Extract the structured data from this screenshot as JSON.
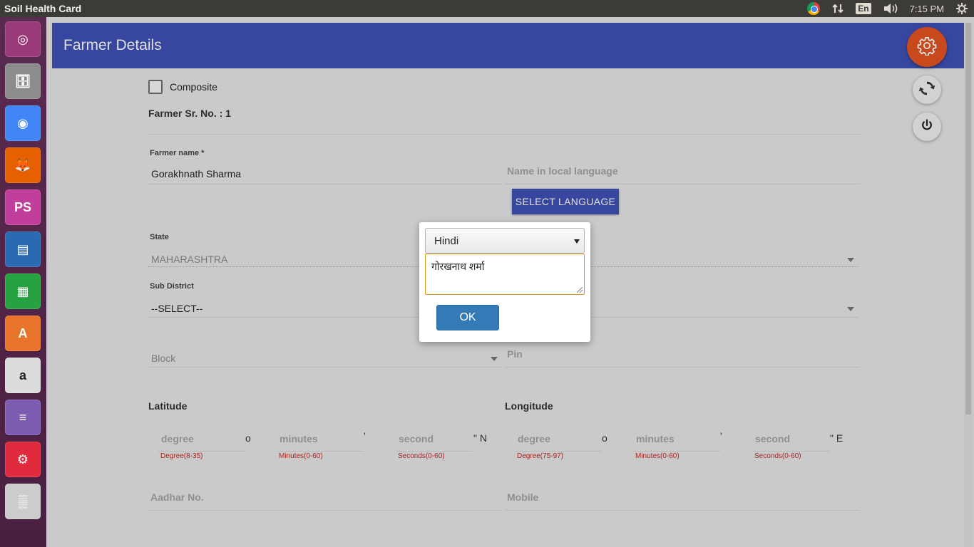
{
  "system": {
    "window_title": "Soil Health Card",
    "keyboard_language": "En",
    "clock": "7:15 PM"
  },
  "launcher": {
    "items": [
      {
        "name": "ubuntu-dash",
        "glyph": "◎",
        "color": "#9b3a7a"
      },
      {
        "name": "files",
        "glyph": "🗄",
        "color": "#8c8c8c"
      },
      {
        "name": "chrome",
        "glyph": "◉",
        "color": "#4285f4"
      },
      {
        "name": "firefox",
        "glyph": "🦊",
        "color": "#e66000"
      },
      {
        "name": "phpstorm",
        "glyph": "PS",
        "color": "#c13f9b"
      },
      {
        "name": "libreoffice-impress",
        "glyph": "▤",
        "color": "#2a6ab2"
      },
      {
        "name": "libreoffice-calc",
        "glyph": "▦",
        "color": "#27a243"
      },
      {
        "name": "software-center",
        "glyph": "A",
        "color": "#e7742a"
      },
      {
        "name": "amazon",
        "glyph": "a",
        "color": "#dcdcdc"
      },
      {
        "name": "stacked-apps",
        "glyph": "≡",
        "color": "#7c5bb0"
      },
      {
        "name": "screenshot-tool",
        "glyph": "⚙",
        "color": "#e02a3d"
      },
      {
        "name": "misc-app",
        "glyph": "▒",
        "color": "#cccccc"
      }
    ]
  },
  "app": {
    "title": "Farmer Details",
    "composite_label": "Composite",
    "farmer_sr_no_label": "Farmer Sr. No. : 1",
    "farmer_name_label": "Farmer name *",
    "farmer_name_value": "Gorakhnath Sharma",
    "local_name_placeholder": "Name in local language",
    "select_language_button": "SELECT LANGUAGE",
    "state_label": "State",
    "state_value": "MAHARASHTRA",
    "sub_district_label": "Sub District",
    "sub_district_value": "--SELECT--",
    "block_placeholder": "Block",
    "pin_placeholder": "Pin",
    "latitude": {
      "title": "Latitude",
      "degree_ph": "degree",
      "degree_sym": "o",
      "degree_hint": "Degree(8-35)",
      "minutes_ph": "minutes",
      "minutes_sym": "'",
      "minutes_hint": "Minutes(0-60)",
      "second_ph": "second",
      "second_sym": "\" N",
      "second_hint": "Seconds(0-60)"
    },
    "longitude": {
      "title": "Longitude",
      "degree_ph": "degree",
      "degree_sym": "o",
      "degree_hint": "Degree(75-97)",
      "minutes_ph": "minutes",
      "minutes_sym": "'",
      "minutes_hint": "Minutes(0-60)",
      "second_ph": "second",
      "second_sym": "\" E",
      "second_hint": "Seconds(0-60)"
    },
    "aadhar_placeholder": "Aadhar No.",
    "mobile_placeholder": "Mobile"
  },
  "dialog": {
    "language_selected": "Hindi",
    "translated_text": "गोरखनाथ शर्मा",
    "ok_label": "OK"
  },
  "colors": {
    "header": "#3f51b5",
    "fab_settings": "#e4541f",
    "ok_button": "#337ab7",
    "hint_error": "#c62828"
  }
}
